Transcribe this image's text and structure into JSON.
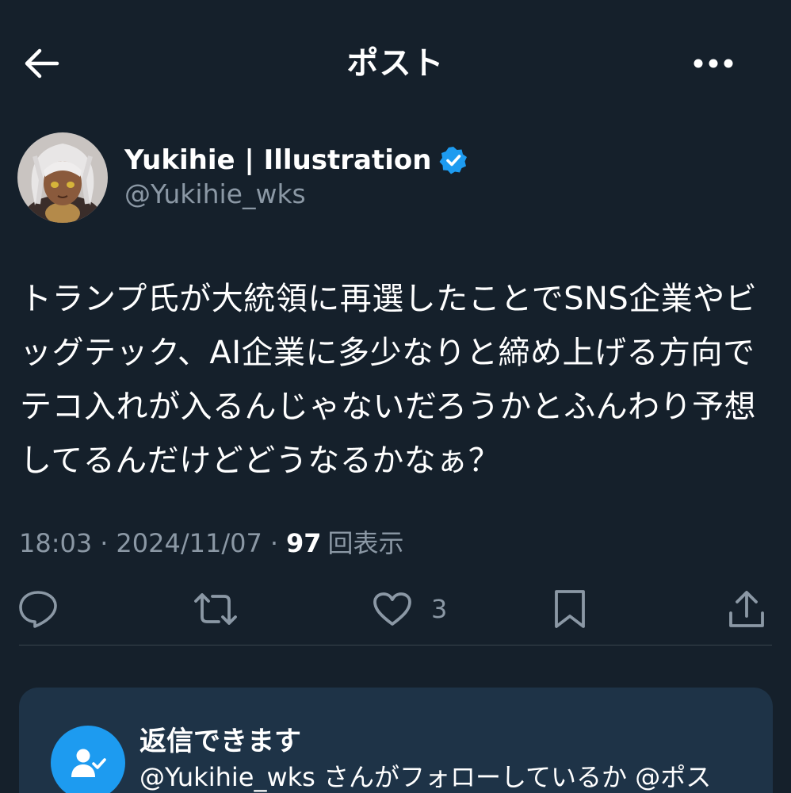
{
  "header": {
    "title": "ポスト",
    "back_icon": "arrow-left-icon",
    "more_icon": "more-horizontal-icon"
  },
  "author": {
    "name": "Yukihie | Illustration",
    "handle": "@Yukihie_wks",
    "verified": true,
    "verified_color": "#1d9bf0"
  },
  "post": {
    "text": "トランプ氏が大統領に再選したことでSNS企業やビ\nッグテック、AI企業に多少なりと締め上げる方向で\nテコ入れが入るんじゃないだろうかとふんわり予想\nしてるんだけどどうなるかなぁ？",
    "time": "18:03",
    "separator": "·",
    "date": "2024/11/07",
    "views_count": "97",
    "views_label": "回表示"
  },
  "actions": {
    "reply_icon": "reply-icon",
    "repost_icon": "repost-icon",
    "like_icon": "heart-icon",
    "like_count": "3",
    "bookmark_icon": "bookmark-icon",
    "share_icon": "share-icon"
  },
  "reply_restriction": {
    "icon": "user-check-icon",
    "title": "返信できます",
    "description": "@Yukihie_wks さんがフォローしているか @ポス"
  },
  "colors": {
    "background": "#15202b",
    "text": "#ffffff",
    "secondary": "#8b98a5",
    "accent": "#1d9bf0",
    "card": "#1e3347",
    "divider": "#38444d"
  }
}
